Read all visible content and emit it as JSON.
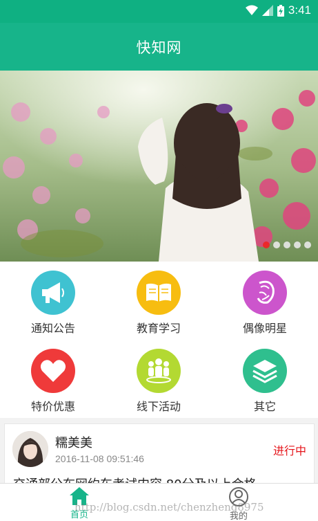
{
  "status_bar": {
    "time": "3:41"
  },
  "app_bar": {
    "title": "快知网"
  },
  "banner": {
    "slide_count": 5,
    "active_slide": 0
  },
  "grid": {
    "items": [
      {
        "label": "通知公告",
        "icon": "megaphone-icon",
        "color": "#3fc2d1"
      },
      {
        "label": "教育学习",
        "icon": "book-icon",
        "color": "#f7bd10"
      },
      {
        "label": "偶像明星",
        "icon": "star-face-icon",
        "color": "#cc55cc"
      },
      {
        "label": "特价优惠",
        "icon": "heart-icon",
        "color": "#ef3a3a"
      },
      {
        "label": "线下活动",
        "icon": "group-icon",
        "color": "#b3d932"
      },
      {
        "label": "其它",
        "icon": "layers-icon",
        "color": "#2fbf8e"
      }
    ]
  },
  "card": {
    "name": "糯美美",
    "time": "2016-11-08 09:51:46",
    "status": "进行中",
    "body": "交通部公布网约车考试内容 80分及以上合格"
  },
  "bottom_nav": {
    "items": [
      {
        "label": "首页",
        "icon": "home-icon",
        "active": true
      },
      {
        "label": "我的",
        "icon": "profile-icon",
        "active": false
      }
    ],
    "active_color": "#17b48a",
    "inactive_color": "#666666"
  },
  "watermark": "http://blog.csdn.net/chenzheng8975"
}
